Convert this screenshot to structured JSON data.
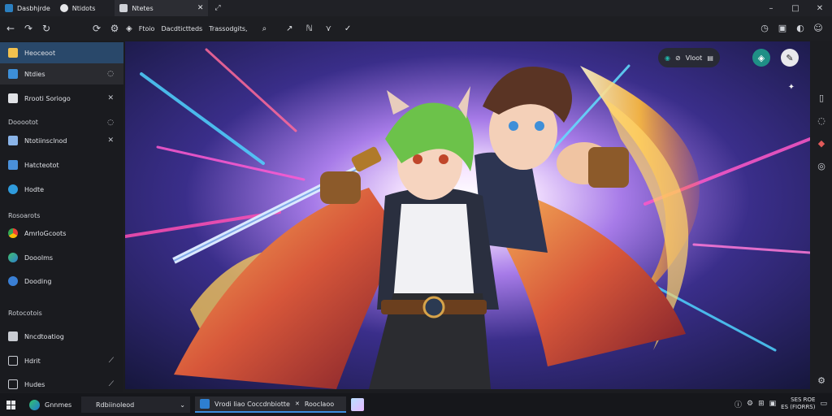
{
  "titlebar": {
    "tabs": [
      {
        "label": "Dasbhjrde",
        "icon": "app-logo-icon"
      },
      {
        "label": "Ntidots",
        "icon": "notes-icon"
      },
      {
        "label": "Ntetes",
        "icon": "page-icon"
      }
    ],
    "controls": [
      "–",
      "□",
      "✕"
    ]
  },
  "toolbar": {
    "address_parts": [
      "Ftoio",
      "Dacdtictteds",
      "Trassodgits,"
    ]
  },
  "sidebar": {
    "items": [
      {
        "label": "Heoceoot",
        "icon": "folder-icon"
      },
      {
        "label": "Ntdies",
        "icon": "notes-icon"
      },
      {
        "label": "Rrooti Soriogo",
        "icon": "home-icon"
      },
      {
        "label": "Ntotiinsclnod",
        "icon": "tool-icon"
      },
      {
        "label": "Hatcteotot",
        "icon": "doc-icon"
      },
      {
        "label": "Hodte",
        "icon": "globe-icon"
      },
      {
        "label": "AmrloGcoots",
        "icon": "chrome-icon"
      },
      {
        "label": "Dooolms",
        "icon": "app-icon"
      },
      {
        "label": "Dooding",
        "icon": "settings-icon"
      },
      {
        "label": "Nncdtoatiog",
        "icon": "edit-icon"
      },
      {
        "label": "Hdrit",
        "icon": "window-icon"
      },
      {
        "label": "Hudes",
        "icon": "window-icon"
      }
    ],
    "headers": [
      "Dooootot",
      "Rosoarots",
      "Rotocotois"
    ]
  },
  "overlay": {
    "pill_label": "Vloot"
  },
  "taskbar": {
    "search_label": "Gnnmes",
    "field_label": "Rdbiinoleod",
    "active_task": "Vrodi liao Coccdnbiotte",
    "secondary_task": "Rooclaoo",
    "clock_top": "SES ROE",
    "clock_bottom": "ES (FIORRS)"
  },
  "colors": {
    "accent": "#2e6ea6",
    "active_item": "#29486a",
    "background": "#1b1c20"
  }
}
